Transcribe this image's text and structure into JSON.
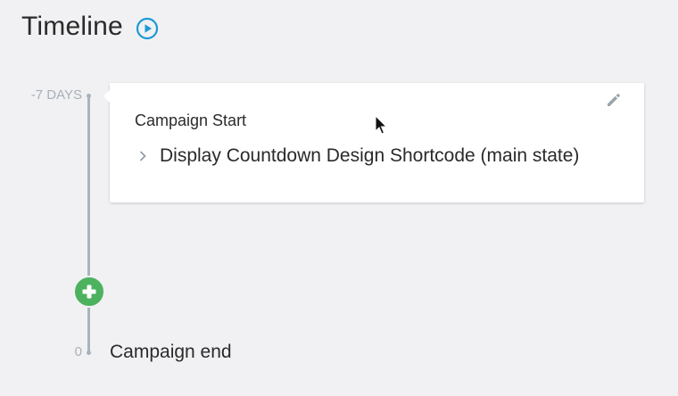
{
  "header": {
    "title": "Timeline",
    "play_icon": "play-circle-icon"
  },
  "timeline": {
    "start_tick_label": "-7 DAYS",
    "end_tick_label": "0",
    "line_color": "#a7b4bd"
  },
  "card": {
    "title": "Campaign Start",
    "edit_icon": "pencil-icon",
    "steps": [
      {
        "label": "Display Countdown Design Shortcode (main state)",
        "icon": "chevron-right-icon"
      }
    ]
  },
  "add_button": {
    "icon": "plus-icon",
    "color": "#4cb25f"
  },
  "end": {
    "label": "Campaign end"
  },
  "colors": {
    "accent": "#1a9ad6",
    "background": "#f1f1f3"
  }
}
